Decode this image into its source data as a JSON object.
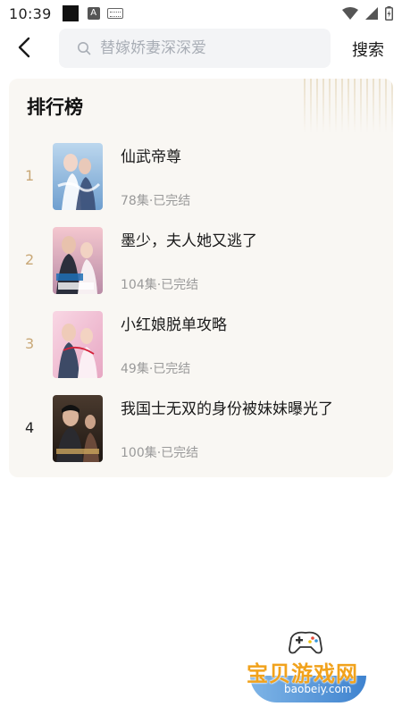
{
  "status_bar": {
    "time": "10:39",
    "a_badge": "A"
  },
  "header": {
    "search_placeholder": "替嫁娇妻深深爱",
    "search_label": "搜索"
  },
  "ranking": {
    "title": "排行榜",
    "items": [
      {
        "rank": "1",
        "title": "仙武帝尊",
        "meta": "78集·已完结"
      },
      {
        "rank": "2",
        "title": "墨少，夫人她又逃了",
        "meta": "104集·已完结"
      },
      {
        "rank": "3",
        "title": "小红娘脱单攻略",
        "meta": "49集·已完结"
      },
      {
        "rank": "4",
        "title": "我国士无双的身份被妹妹曝光了",
        "meta": "100集·已完结"
      }
    ]
  },
  "watermark": {
    "name": "宝贝游戏网",
    "url": "baobeiy.com"
  }
}
